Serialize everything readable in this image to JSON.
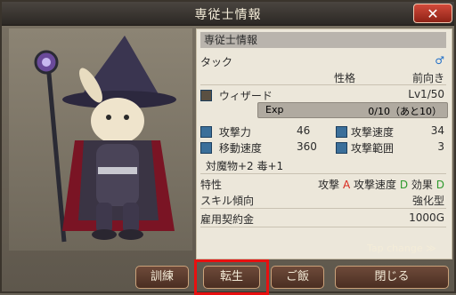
{
  "window": {
    "title": "専従士情報",
    "close_label": "✕"
  },
  "panel": {
    "header": "専従士情報",
    "name": "タック",
    "gender_symbol": "♂",
    "personality_label": "性格",
    "personality_value": "前向き",
    "class_name": "ウィザード",
    "level": "Lv1/50",
    "exp_label": "Exp",
    "exp_value": "0/10（あと10）",
    "exp_progress": 0,
    "stats": [
      {
        "label": "攻撃力",
        "value": "46"
      },
      {
        "label": "攻撃速度",
        "value": "34"
      },
      {
        "label": "移動速度",
        "value": "360"
      },
      {
        "label": "攻撃範囲",
        "value": "3"
      }
    ],
    "bonus": "対魔物+2 毒+1",
    "traits_label": "特性",
    "traits": [
      {
        "label": "攻撃",
        "grade": "A"
      },
      {
        "label": "攻撃速度",
        "grade": "D"
      },
      {
        "label": "効果",
        "grade": "D"
      }
    ],
    "skill_tendency_label": "スキル傾向",
    "skill_tendency_value": "強化型",
    "fee_label": "雇用契約金",
    "fee_value": "1000G"
  },
  "tap_change": "Tap change ≫",
  "buttons": {
    "train": "訓練",
    "rebirth": "転生",
    "meal": "ご飯",
    "close": "閉じる"
  },
  "colors": {
    "grade_a": "#d8261c",
    "grade_d": "#2e9a2e",
    "male": "#1f6fc8"
  }
}
